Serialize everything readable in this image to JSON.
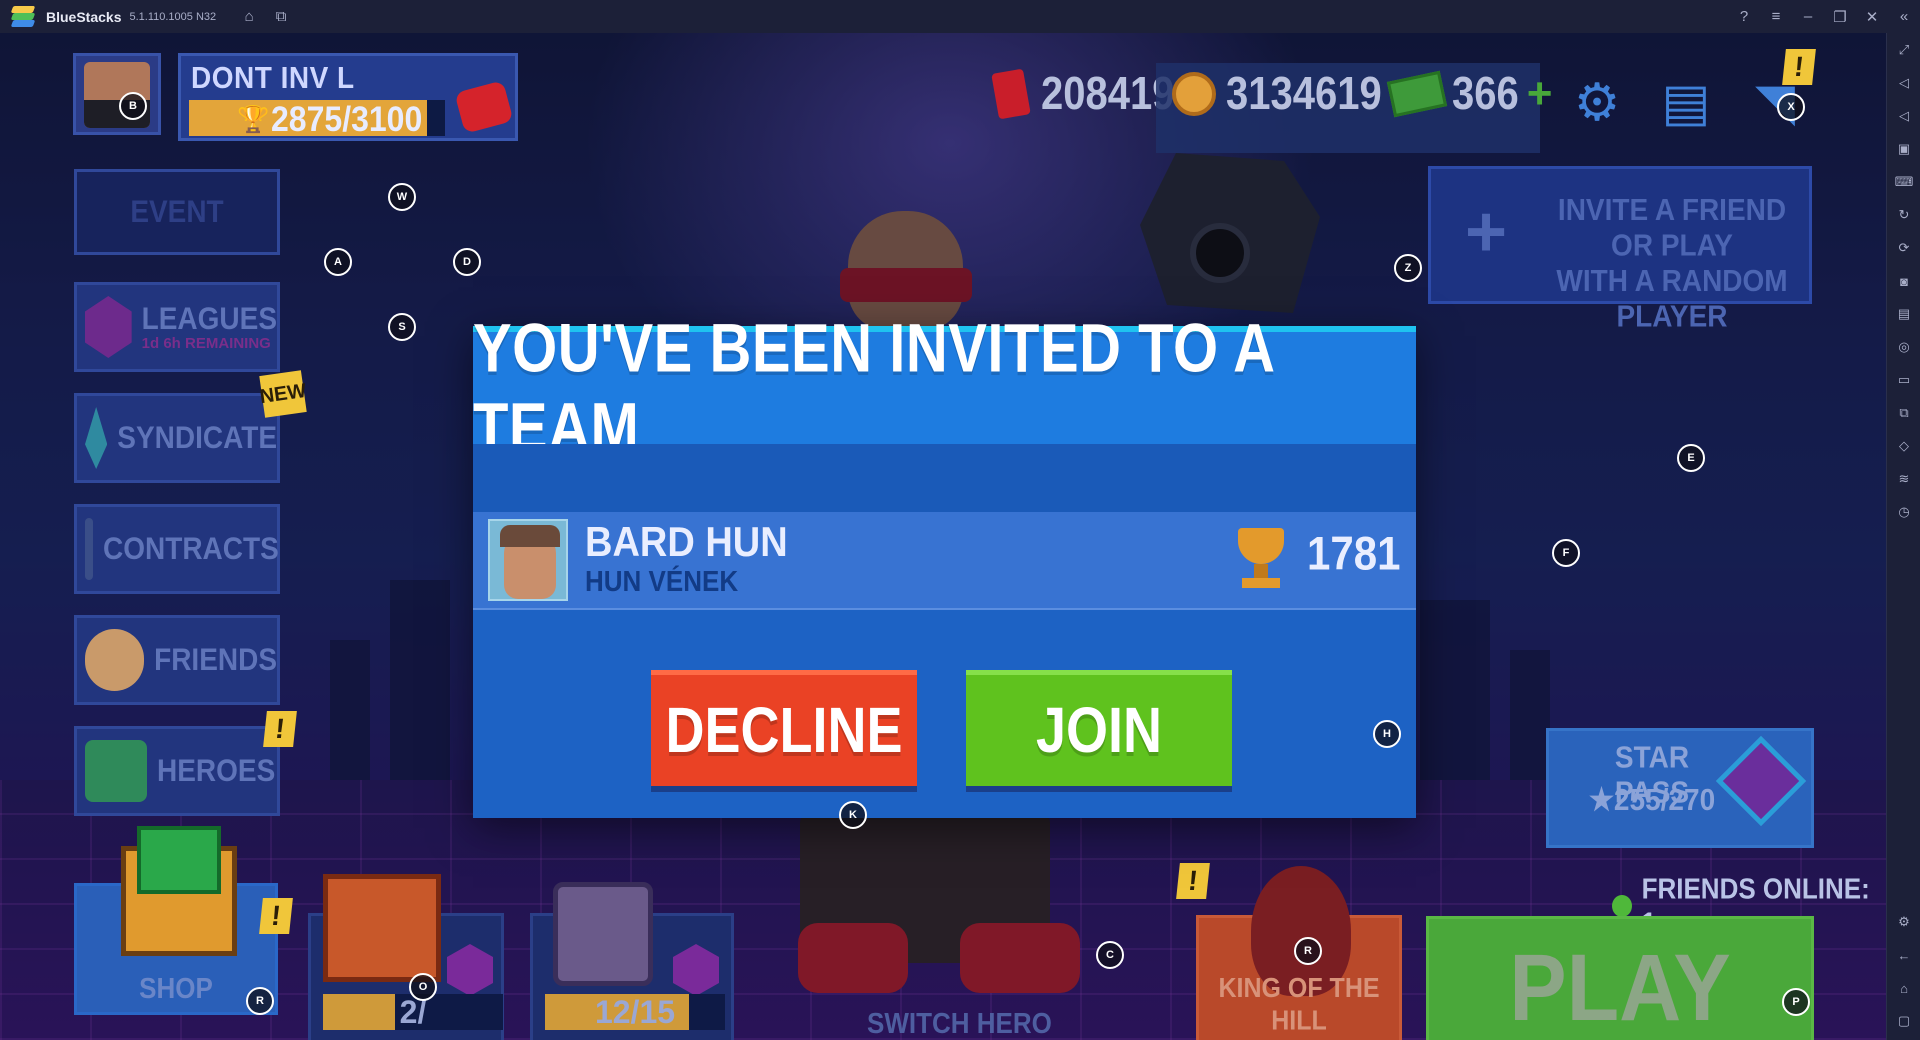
{
  "window": {
    "app_name": "BlueStacks",
    "version": "5.1.110.1005 N32"
  },
  "hud": {
    "player_name": "DONT INV L",
    "trophies": "2875/3100",
    "trophy_progress": 0.93,
    "energy": "208419",
    "coins": "3134619",
    "cash": "366",
    "plus_symbol": "+"
  },
  "left_menu": {
    "event": "EVENT",
    "leagues": "LEAGUES",
    "leagues_sub": "1d 6h REMAINING",
    "syndicate": "SYNDICATE",
    "new_badge": "NEW",
    "contracts": "CONTRACTS",
    "friends": "FRIENDS",
    "heroes": "HEROES"
  },
  "invite_panel": {
    "plus": "+",
    "line1": "INVITE A FRIEND OR PLAY",
    "line2": "WITH A RANDOM PLAYER"
  },
  "modal": {
    "title": "YOU'VE BEEN INVITED TO A TEAM",
    "inviter_name": "BARD HUN",
    "inviter_team": "HUN VÉNEK",
    "inviter_trophies": "1781",
    "decline": "DECLINE",
    "join": "JOIN"
  },
  "star_pass": {
    "title": "STAR PASS",
    "value": "★255/270"
  },
  "friends_online": "FRIENDS ONLINE: 1",
  "bottom": {
    "shop": "SHOP",
    "chest1_count": "2/",
    "chest1_progress": 0.4,
    "chest2_count": "12/15",
    "chest2_progress": 0.8,
    "switch_hero": "SWITCH HERO",
    "king_of_the_hill": "KING OF THE HILL",
    "play": "PLAY"
  },
  "alert_symbol": "!",
  "key_markers": {
    "b": "B",
    "w": "W",
    "a": "A",
    "d": "D",
    "s": "S",
    "z": "Z",
    "x": "X",
    "e": "E",
    "f": "F",
    "h": "H",
    "k": "K",
    "c": "C",
    "r1": "R",
    "o": "O",
    "r2": "R",
    "p": "P"
  },
  "colors": {
    "decline": "#ea4225",
    "join": "#5fc21e",
    "modal_header": "#1e7ce0",
    "modal_accent": "#1fc3f0",
    "play": "#4aa83a"
  },
  "icons": [
    "bluestacks-logo-icon",
    "home-icon",
    "multi-instance-icon",
    "help-icon",
    "menu-icon",
    "minimize-icon",
    "restore-icon",
    "close-icon",
    "collapse-sidebar-icon",
    "gear-icon",
    "news-icon",
    "chat-icon",
    "trophy-icon",
    "energy-icon",
    "coin-icon",
    "cash-icon"
  ]
}
